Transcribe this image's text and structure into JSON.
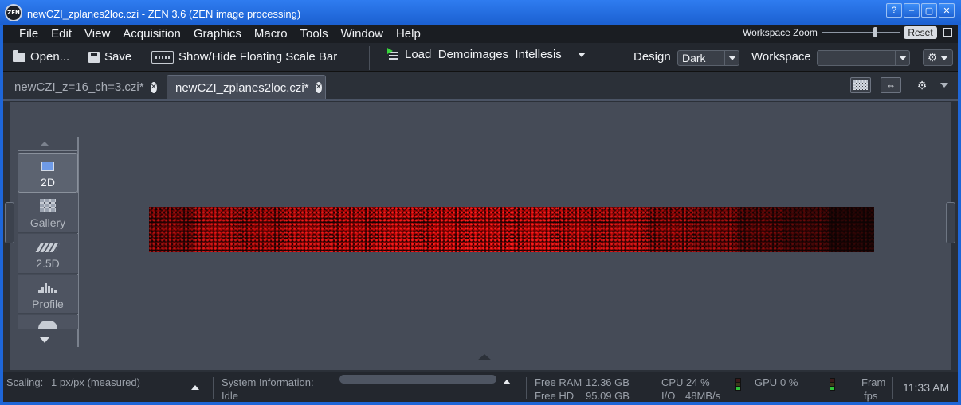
{
  "window": {
    "logo_text": "ZEN",
    "title": "newCZI_zplanes2loc.czi - ZEN 3.6 (ZEN image processing)",
    "buttons": [
      "?",
      "–",
      "▢",
      "✕"
    ]
  },
  "menubar": {
    "items": [
      "File",
      "Edit",
      "View",
      "Acquisition",
      "Graphics",
      "Macro",
      "Tools",
      "Window",
      "Help"
    ],
    "workspace_zoom_label": "Workspace Zoom",
    "reset_label": "Reset"
  },
  "toolbar": {
    "open_label": "Open...",
    "save_label": "Save",
    "scalebar_label": "Show/Hide Floating Scale Bar",
    "macro_label": "Load_Demoimages_Intellesis",
    "design_label": "Design",
    "design_value": "Dark",
    "workspace_label": "Workspace",
    "workspace_value": ""
  },
  "tabs": [
    {
      "label": "newCZI_z=16_ch=3.czi*",
      "active": false
    },
    {
      "label": "newCZI_zplanes2loc.czi*",
      "active": true
    }
  ],
  "view_nav": {
    "items": [
      {
        "label": "2D",
        "icon": "2d-view-icon",
        "active": true
      },
      {
        "label": "Gallery",
        "icon": "gallery-icon",
        "active": false
      },
      {
        "label": "2.5D",
        "icon": "2-5d-icon",
        "active": false
      },
      {
        "label": "Profile",
        "icon": "profile-icon",
        "active": false
      }
    ]
  },
  "image_strip": {
    "tile_count": 16,
    "tile_intensity": [
      0.55,
      0.75,
      0.8,
      0.85,
      0.9,
      0.95,
      1.0,
      1.0,
      0.95,
      0.9,
      0.8,
      0.65,
      0.5,
      0.35,
      0.22,
      0.1
    ],
    "color": "#c40d0d"
  },
  "statusbar": {
    "scaling_label": "Scaling:",
    "scaling_value": "1 px/px (measured)",
    "sysinfo_label": "System Information:",
    "sysinfo_value": "Idle",
    "free_ram_label": "Free RAM",
    "free_ram_value": "12.36 GB",
    "free_hd_label": "Free HD",
    "free_hd_value": "95.09 GB",
    "cpu_label": "CPU",
    "cpu_value": "24 %",
    "io_label": "I/O",
    "io_value": "48MB/s",
    "gpu_label": "GPU",
    "gpu_value": "0 %",
    "frame_label": "Fram",
    "fps_label": "fps",
    "time": "11:33 AM"
  },
  "colors": {
    "titlebar": "#1a5fd0",
    "background": "#2b3038",
    "viewer": "#454b57",
    "accent_green": "#38d33c"
  }
}
